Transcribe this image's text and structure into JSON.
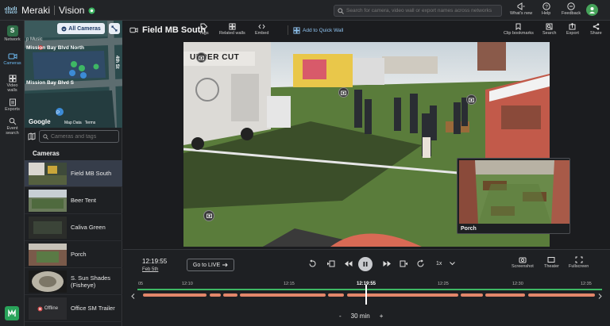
{
  "topbar": {
    "brand_cisco": "cisco",
    "brand_name": "Meraki",
    "product": "Vision",
    "search_placeholder": "Search for camera, video wall or export names across networks",
    "whats_new": "What's new",
    "help": "Help",
    "feedback": "Feedback",
    "avatar_initial": "S"
  },
  "rail": {
    "items": [
      {
        "label": "Network",
        "icon": "network-icon"
      },
      {
        "label": "Cameras",
        "icon": "camera-icon"
      },
      {
        "label": "Video walls",
        "icon": "grid-icon"
      },
      {
        "label": "Exports",
        "icon": "export-icon"
      },
      {
        "label": "Event search",
        "icon": "event-search-icon"
      }
    ],
    "network_letter": "S"
  },
  "sidebar": {
    "all_cameras": "All Cameras",
    "map_street_1": "Mission Bay Blvd North",
    "map_street_2": "Mission Bay Blvd S",
    "map_street_3": "4th St",
    "map_music": "p Music",
    "google": "Google",
    "map_data": "Map Data",
    "terms": "Terms",
    "search_placeholder": "Cameras and tags",
    "cameras_header": "Cameras",
    "cameras": [
      {
        "name": "Field MB South",
        "active": true
      },
      {
        "name": "Beer Tent",
        "active": false
      },
      {
        "name": "Caliva Green",
        "active": false
      },
      {
        "name": "Porch",
        "active": false
      },
      {
        "name": "S. Sun Shades (Fisheye)",
        "active": false
      },
      {
        "name": "Office SM Trailer",
        "active": false,
        "offline": "Offline"
      }
    ]
  },
  "main": {
    "title": "Field MB South",
    "tools": {
      "tags": "Tags",
      "related_walls": "Related walls",
      "embed": "Embed",
      "quick_wall": "Add to Quick Wall",
      "clip_bookmarks": "Clip bookmarks",
      "search": "Search",
      "export": "Export",
      "share": "Share"
    },
    "video": {
      "truck_sign": "UPPER CUT",
      "pip_label": "Porch"
    }
  },
  "controls": {
    "time": "12:19:55",
    "date": "Feb 5th",
    "go_live": "Go to LIVE",
    "speed": "1x",
    "screenshot": "Screenshot",
    "theater": "Theater",
    "fullscreen": "Fullscreen",
    "ticks": [
      "05",
      "12:10",
      "12:15",
      "12:19:55",
      "12:25",
      "12:30",
      "12:35"
    ],
    "zoom_minus": "-",
    "zoom_label": "30 min",
    "zoom_plus": "+"
  }
}
